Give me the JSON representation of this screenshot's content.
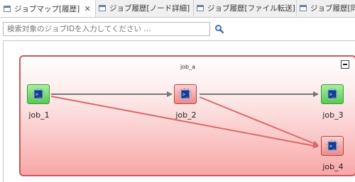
{
  "tabs": [
    {
      "label": "ジョブマップ[履歴]",
      "active": true,
      "closable": true
    },
    {
      "label": "ジョブ履歴[ノード詳細]",
      "active": false,
      "closable": false
    },
    {
      "label": "ジョブ履歴[ファイル転送]",
      "active": false,
      "closable": false
    },
    {
      "label": "ジョブ履歴[同",
      "active": false,
      "closable": false
    }
  ],
  "search": {
    "placeholder": "検索対象のジョブIDを入力してください …",
    "value": ""
  },
  "icons": {
    "tab": "view-icon",
    "close": "close-icon",
    "search": "magnifier-icon",
    "collapse": "collapse-icon",
    "job": "job-command-icon"
  },
  "job_group": {
    "title": "job_a"
  },
  "jobs": [
    {
      "id": "job_1",
      "status": "success",
      "color": "#57c94d"
    },
    {
      "id": "job_2",
      "status": "error",
      "color": "#f08888"
    },
    {
      "id": "job_3",
      "status": "success",
      "color": "#57c94d"
    },
    {
      "id": "job_4",
      "status": "error",
      "color": "#f08888"
    }
  ],
  "edges": [
    {
      "from": "job_1",
      "to": "job_2"
    },
    {
      "from": "job_2",
      "to": "job_3"
    },
    {
      "from": "job_1",
      "to": "job_4"
    },
    {
      "from": "job_2",
      "to": "job_4"
    }
  ],
  "colors": {
    "group_border": "#c9575b",
    "edge_success": "#777777",
    "edge_error": "#d96a6a"
  }
}
